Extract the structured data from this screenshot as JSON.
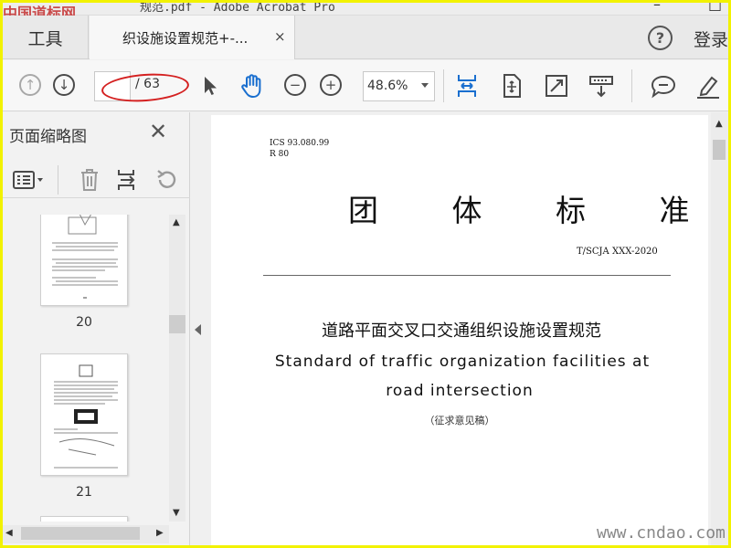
{
  "watermark": {
    "top": "中国道标网",
    "bottom": "www.cndao.com"
  },
  "window": {
    "title_fragment": "规范.pdf - Adobe Acrobat Pro",
    "controls": [
      "–",
      "□"
    ]
  },
  "tabs": {
    "tools": "工具",
    "document": "织设施设置规范+-...",
    "close": "×"
  },
  "header": {
    "help": "?",
    "login": "登录"
  },
  "toolbar": {
    "current_page": "",
    "total_pages": "/ 63",
    "zoom": "48.6%",
    "prev_page": "↑",
    "next_page": "↓",
    "zoom_out": "−",
    "zoom_in": "+"
  },
  "left_panel": {
    "title": "页面缩略图",
    "close": "✕",
    "thumbnails": [
      {
        "page": "20"
      },
      {
        "page": "21"
      }
    ]
  },
  "document": {
    "ics": "ICS 93.080.99",
    "r_code": "R 80",
    "big_title": "团 体 标 准",
    "standard_no": "T/SCJA XXX-2020",
    "cn_name": "道路平面交叉口交通组织设施设置规范",
    "en_line1": "Standard of traffic organization facilities at",
    "en_line2": "road intersection",
    "draft_label": "（征求意见稿）"
  },
  "colors": {
    "accent_blue": "#1a6fcf",
    "annotation_red": "#d42020",
    "border_yellow": "#f2f200"
  }
}
